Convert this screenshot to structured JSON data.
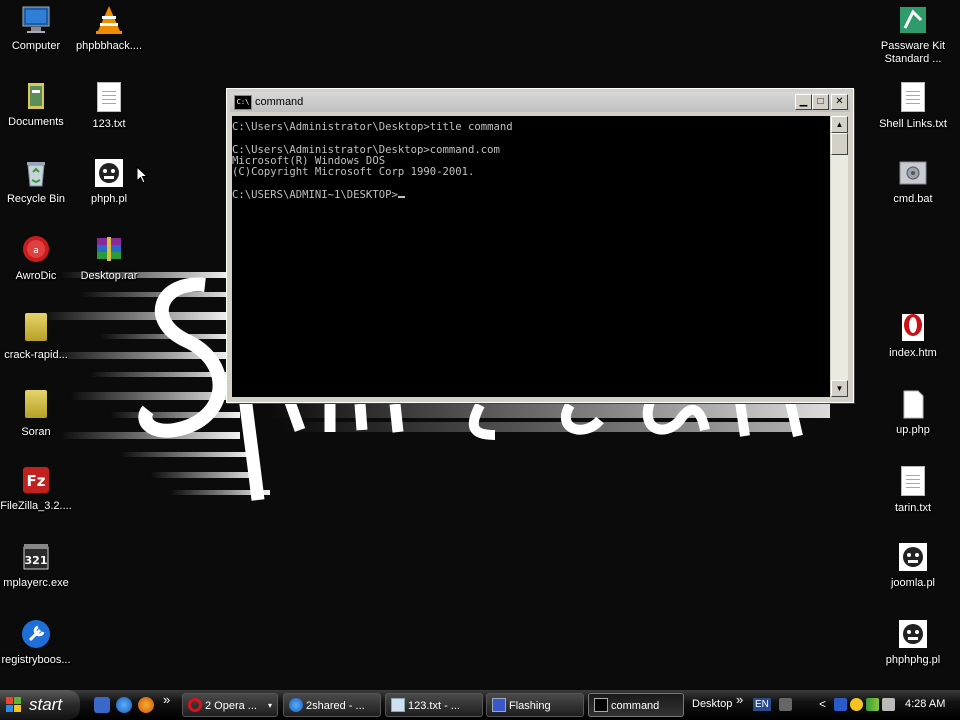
{
  "desktop": {
    "left_icons": [
      {
        "label": "Computer",
        "icon": "computer-icon"
      },
      {
        "label": "phpbbhack....",
        "icon": "vlc-icon"
      },
      {
        "label": "Documents",
        "icon": "documents-icon"
      },
      {
        "label": "123.txt",
        "icon": "text-file-icon"
      },
      {
        "label": "Recycle Bin",
        "icon": "recycle-bin-icon"
      },
      {
        "label": "phph.pl",
        "icon": "perl-script-icon"
      },
      {
        "label": "AwroDic",
        "icon": "awrodic-icon"
      },
      {
        "label": "Desktop.rar",
        "icon": "rar-archive-icon"
      },
      {
        "label": "crack-rapid...",
        "icon": "folder-icon"
      },
      {
        "label": "Soran",
        "icon": "folder-icon"
      },
      {
        "label": "FileZilla_3.2....",
        "icon": "filezilla-icon"
      },
      {
        "label": "mplayerc.exe",
        "icon": "media-player-icon"
      },
      {
        "label": "registryboos...",
        "icon": "registry-booster-icon"
      }
    ],
    "right_icons": [
      {
        "label": "Passware Kit Standard ...",
        "icon": "passware-icon"
      },
      {
        "label": "Shell Links.txt",
        "icon": "text-file-icon"
      },
      {
        "label": "cmd.bat",
        "icon": "batch-file-icon"
      },
      {
        "label": "index.htm",
        "icon": "opera-html-icon"
      },
      {
        "label": "up.php",
        "icon": "blank-file-icon"
      },
      {
        "label": "tarin.txt",
        "icon": "text-file-icon"
      },
      {
        "label": "joomla.pl",
        "icon": "perl-script-icon"
      },
      {
        "label": "phphphg.pl",
        "icon": "perl-script-icon"
      }
    ]
  },
  "cmd_window": {
    "title": "command",
    "title_icon_text": "C:\\",
    "lines": [
      "C:\\Users\\Administrator\\Desktop>title command",
      "",
      "C:\\Users\\Administrator\\Desktop>command.com",
      "Microsoft(R) Windows DOS",
      "(C)Copyright Microsoft Corp 1990-2001.",
      "",
      "C:\\USERS\\ADMINI~1\\DESKTOP>"
    ],
    "minimize_glyph": "▁",
    "maximize_glyph": "□",
    "close_glyph": "✕",
    "scroll_up_glyph": "▲",
    "scroll_down_glyph": "▼"
  },
  "taskbar": {
    "start_label": "start",
    "tasks": [
      {
        "label": "2 Opera ...",
        "icon": "opera-icon",
        "has_dropdown": true
      },
      {
        "label": "2shared - ...",
        "icon": "internet-explorer-icon"
      },
      {
        "label": "123.txt - ...",
        "icon": "notepad-icon"
      },
      {
        "label": "Flashing",
        "icon": "flashing-app-icon"
      },
      {
        "label": "command",
        "icon": "console-icon",
        "active": true
      }
    ],
    "desktop_toolbar": "Desktop",
    "language": "EN",
    "clock": "4:28 AM",
    "chevron": "»",
    "tray_left_arrow": "<",
    "dropdown_glyph": "▾"
  }
}
